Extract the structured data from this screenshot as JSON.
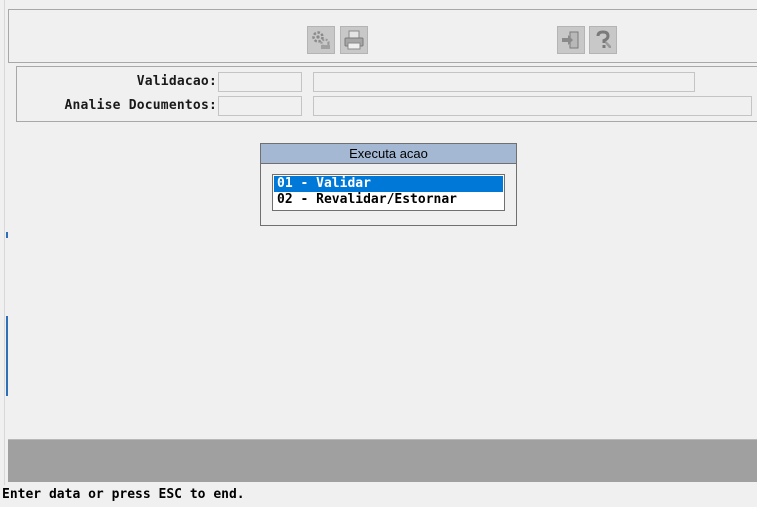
{
  "toolbar": {
    "buttons": [
      {
        "name": "execute-icon",
        "state": "disabled"
      },
      {
        "name": "print-icon",
        "state": "disabled"
      },
      {
        "name": "exit-icon",
        "state": "disabled"
      },
      {
        "name": "help-icon",
        "state": "disabled"
      }
    ]
  },
  "fields": {
    "validacao_label": "Validacao:",
    "validacao_code": "",
    "validacao_desc": "",
    "analise_label": "Analise Documentos:",
    "analise_code": "",
    "analise_desc": ""
  },
  "dialog": {
    "title": "Executa acao",
    "options": [
      "01 - Validar",
      "02 - Revalidar/Estornar"
    ],
    "selected_index": 0
  },
  "status_bar": {
    "message": "Enter data or press ESC to end."
  },
  "colors": {
    "dialog_title_bg": "#a4b8d3",
    "selection_bg": "#0078d7",
    "bottom_bar": "#a0a0a0"
  }
}
